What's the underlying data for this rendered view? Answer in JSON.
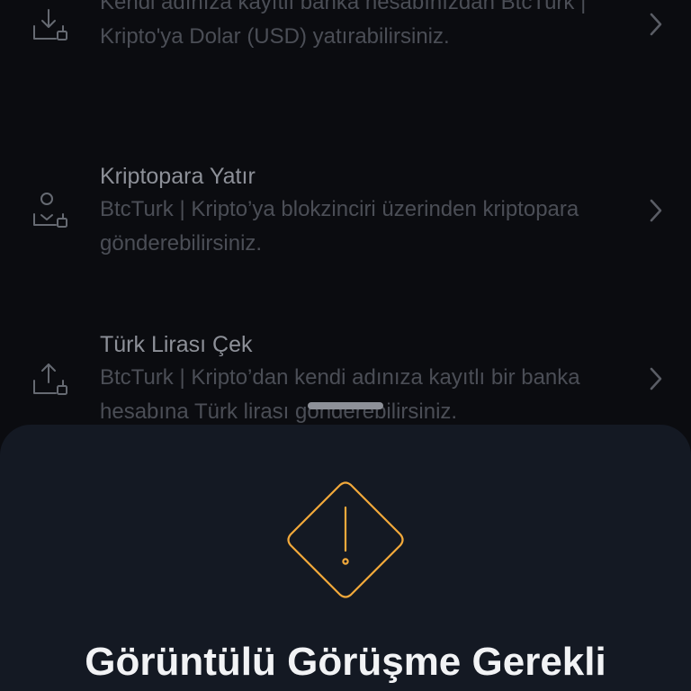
{
  "list": {
    "items": [
      {
        "title": "",
        "description": "Kendi adınıza kayıtlı banka hesabınızdan BtcTurk | Kripto'ya Dolar (USD) yatırabilirsiniz.",
        "icon": "download-tray-icon"
      },
      {
        "title": "Kriptopara Yatır",
        "description": "BtcTurk | Kripto’ya blokzinciri üzerinden kriptopara gönderebilirsiniz.",
        "icon": "crypto-deposit-icon"
      },
      {
        "title": "Türk Lirası Çek",
        "description": "BtcTurk | Kripto’dan kendi adınıza kayıtlı bir banka hesabına Türk lirası gönderebilirsiniz.",
        "icon": "upload-tray-icon"
      }
    ]
  },
  "sheet": {
    "icon": "warning-diamond-icon",
    "title": "Görüntülü Görüşme Gerekli"
  },
  "colors": {
    "background": "#0b0c10",
    "sheet": "#141923",
    "warning": "#f2a93b",
    "title_text": "#f2f3f5",
    "row_title": "#8d9098",
    "row_desc": "#4b4e56"
  }
}
